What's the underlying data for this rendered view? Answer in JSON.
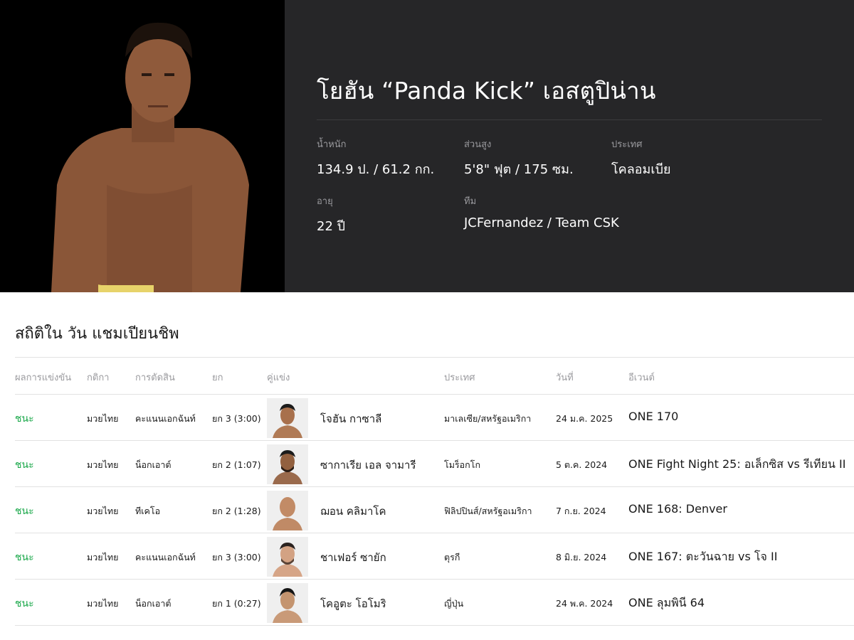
{
  "fighter": {
    "name": "โยฮัน “Panda Kick” เอสตูปิน่าน",
    "stats": {
      "weight_label": "น้ำหนัก",
      "weight_value": "134.9 ป. / 61.2 กก.",
      "height_label": "ส่วนสูง",
      "height_value": "5'8\" ฟุต / 175 ซม.",
      "country_label": "ประเทศ",
      "country_value": "โคลอมเบีย",
      "age_label": "อายุ",
      "age_value": "22 ปี",
      "team_label": "ทีม",
      "team_value": "JCFernandez / Team CSK"
    }
  },
  "records": {
    "title": "สถิติใน วัน แชมเปียนชิพ",
    "headers": {
      "result": "ผลการแข่งขัน",
      "rules": "กติกา",
      "method": "การตัดสิน",
      "round": "ยก",
      "opponent": "คู่แข่ง",
      "country": "ประเทศ",
      "date": "วันที่",
      "event": "อีเวนต์"
    },
    "rows": [
      {
        "result": "ชนะ",
        "rules": "มวยไทย",
        "method": "คะแนนเอกฉันท์",
        "round": "ยก 3 (3:00)",
        "opponent": "โจฮัน กาซาลี",
        "country": "มาเลเซีย/สหรัฐอเมริกา",
        "date": "24 ม.ค. 2025",
        "event": "ONE 170"
      },
      {
        "result": "ชนะ",
        "rules": "มวยไทย",
        "method": "น็อกเอาต์",
        "round": "ยก 2 (1:07)",
        "opponent": "ซากาเรีย เอล จามารี",
        "country": "โมร็อกโก",
        "date": "5 ต.ค. 2024",
        "event": "ONE Fight Night 25: อเล็กซิส vs รีเทียน II"
      },
      {
        "result": "ชนะ",
        "rules": "มวยไทย",
        "method": "ทีเคโอ",
        "round": "ยก 2 (1:28)",
        "opponent": "ฌอน คลิมาโค",
        "country": "ฟิลิปปินส์/สหรัฐอเมริกา",
        "date": "7 ก.ย. 2024",
        "event": "ONE 168: Denver"
      },
      {
        "result": "ชนะ",
        "rules": "มวยไทย",
        "method": "คะแนนเอกฉันท์",
        "round": "ยก 3 (3:00)",
        "opponent": "ชาเฟอร์ ซายัก",
        "country": "ตุรกี",
        "date": "8 มิ.ย. 2024",
        "event": "ONE 167: ตะวันฉาย vs โจ II"
      },
      {
        "result": "ชนะ",
        "rules": "มวยไทย",
        "method": "น็อกเอาต์",
        "round": "ยก 1 (0:27)",
        "opponent": "โคอูตะ โอโมริ",
        "country": "ญี่ปุ่น",
        "date": "24 พ.ค. 2024",
        "event": "ONE ลุมพินี 64"
      }
    ]
  },
  "colors": {
    "hero_bg": "#262628",
    "win_green": "#1aa84a",
    "label_gray": "#9a9a9e"
  }
}
